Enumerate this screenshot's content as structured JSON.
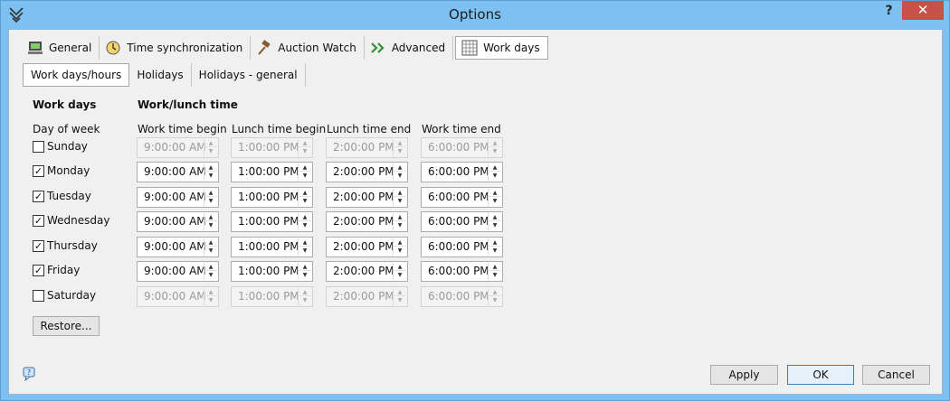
{
  "window": {
    "title": "Options",
    "help_label": "?",
    "close_label": "✕"
  },
  "tabs": [
    {
      "label": "General",
      "icon": "computer-icon"
    },
    {
      "label": "Time synchronization",
      "icon": "clock-sync-icon"
    },
    {
      "label": "Auction Watch",
      "icon": "gavel-icon"
    },
    {
      "label": "Advanced",
      "icon": "double-chevron-icon"
    },
    {
      "label": "Work days",
      "icon": "calendar-grid-icon"
    }
  ],
  "subtabs": [
    "Work days/hours",
    "Holidays",
    "Holidays - general"
  ],
  "headers": {
    "work_days": "Work days",
    "work_lunch": "Work/lunch time",
    "day_of_week": "Day of week",
    "columns": [
      "Work time begin",
      "Lunch time begin",
      "Lunch time end",
      "Work time end"
    ]
  },
  "days": [
    {
      "name": "Sunday",
      "checked": false,
      "times": [
        "9:00:00 AM",
        "1:00:00 PM",
        "2:00:00 PM",
        "6:00:00 PM"
      ]
    },
    {
      "name": "Monday",
      "checked": true,
      "times": [
        "9:00:00 AM",
        "1:00:00 PM",
        "2:00:00 PM",
        "6:00:00 PM"
      ]
    },
    {
      "name": "Tuesday",
      "checked": true,
      "times": [
        "9:00:00 AM",
        "1:00:00 PM",
        "2:00:00 PM",
        "6:00:00 PM"
      ]
    },
    {
      "name": "Wednesday",
      "checked": true,
      "times": [
        "9:00:00 AM",
        "1:00:00 PM",
        "2:00:00 PM",
        "6:00:00 PM"
      ]
    },
    {
      "name": "Thursday",
      "checked": true,
      "times": [
        "9:00:00 AM",
        "1:00:00 PM",
        "2:00:00 PM",
        "6:00:00 PM"
      ]
    },
    {
      "name": "Friday",
      "checked": true,
      "times": [
        "9:00:00 AM",
        "1:00:00 PM",
        "2:00:00 PM",
        "6:00:00 PM"
      ]
    },
    {
      "name": "Saturday",
      "checked": false,
      "times": [
        "9:00:00 AM",
        "1:00:00 PM",
        "2:00:00 PM",
        "6:00:00 PM"
      ]
    }
  ],
  "buttons": {
    "restore": "Restore...",
    "apply": "Apply",
    "ok": "OK",
    "cancel": "Cancel"
  },
  "colors": {
    "titlebar": "#7dc1f2",
    "close": "#c7504a",
    "client": "#f0f0f0"
  }
}
